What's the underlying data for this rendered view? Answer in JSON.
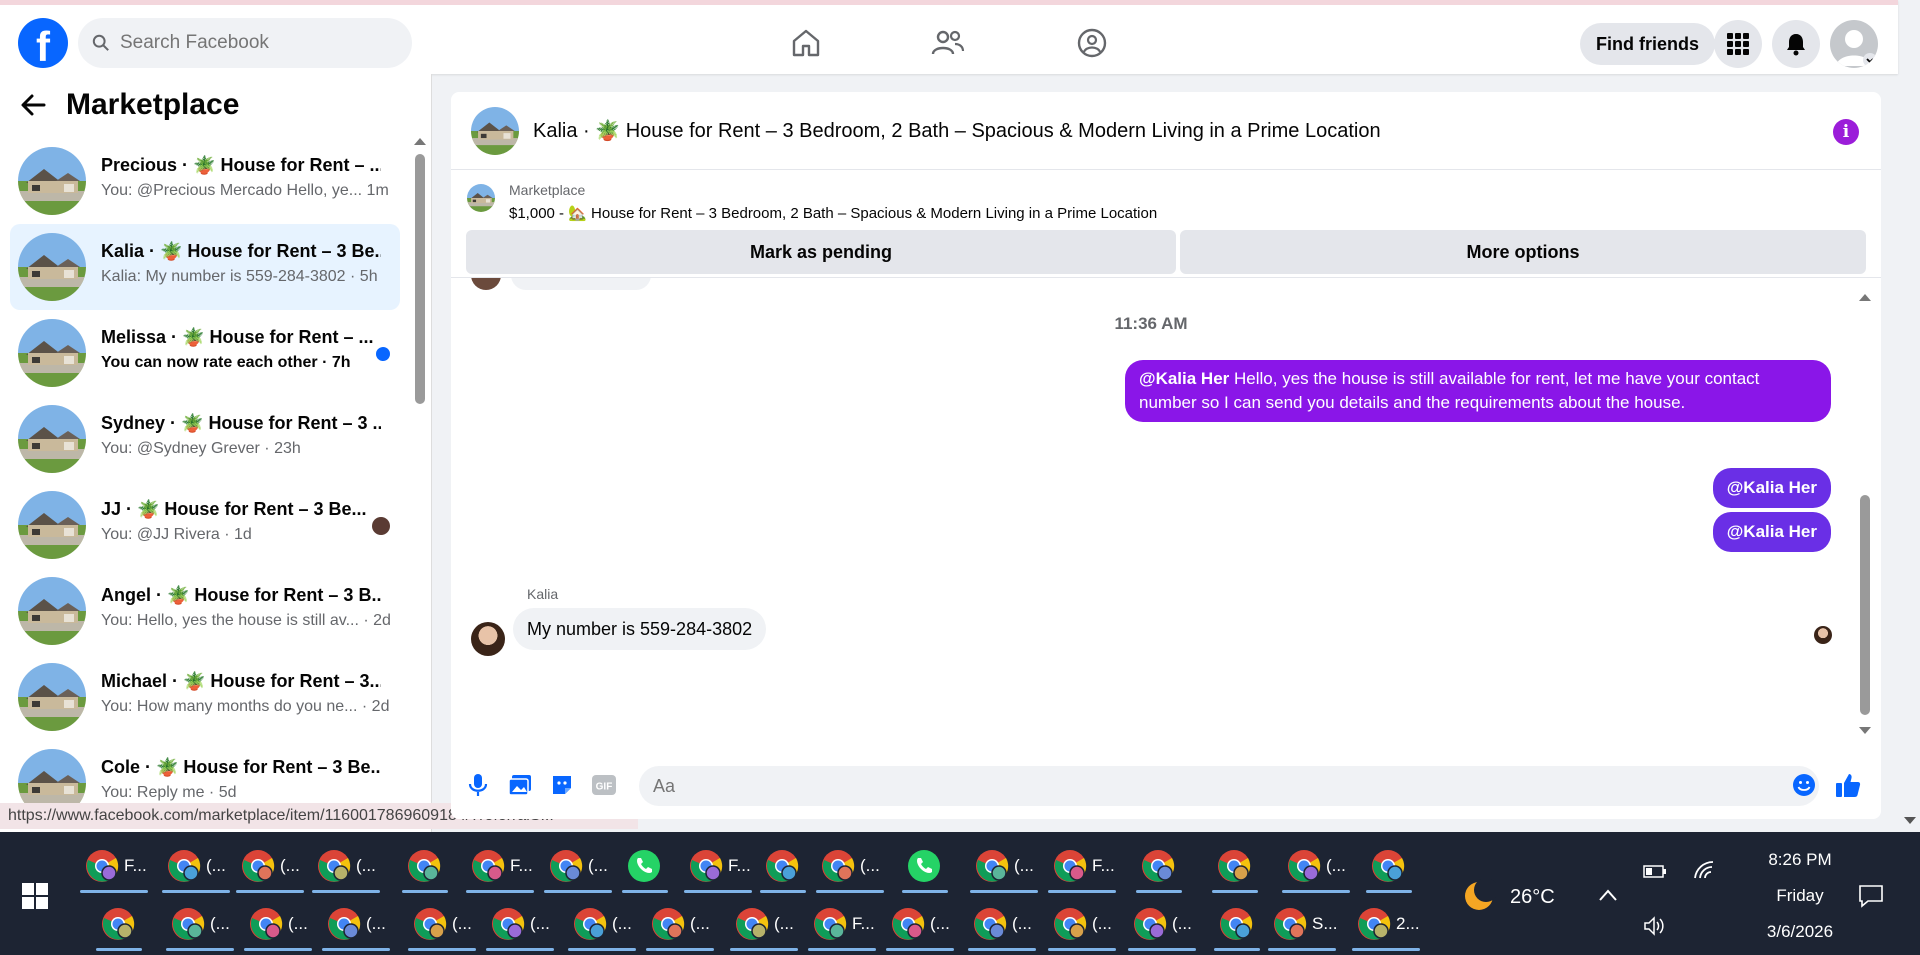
{
  "top": {
    "search_placeholder": "Search Facebook",
    "find_friends": "Find friends"
  },
  "left": {
    "title": "Marketplace",
    "conversations": [
      {
        "name": "Precious · 🪴 House for Rent – ...",
        "preview": "You: @Precious Mercado Hello, ye... 1m",
        "active": false,
        "unread": false
      },
      {
        "name": "Kalia · 🪴 House for Rent – 3 Be...",
        "preview": "Kalia: My number is 559-284-3802 · 5h",
        "active": true,
        "unread": false
      },
      {
        "name": "Melissa · 🪴 House for Rent – ...",
        "preview": "You can now rate each other · 7h",
        "active": false,
        "unread": true
      },
      {
        "name": "Sydney · 🪴 House for Rent – 3 ...",
        "preview": "You: @Sydney Grever · 23h",
        "active": false,
        "unread": false
      },
      {
        "name": "JJ · 🪴 House for Rent – 3 Be...",
        "preview": "You: @JJ Rivera · 1d",
        "active": false,
        "unread": false
      },
      {
        "name": "Angel · 🪴 House for Rent – 3 B...",
        "preview": "You: Hello, yes the house is still av... · 2d",
        "active": false,
        "unread": false
      },
      {
        "name": "Michael · 🪴 House for Rent – 3...",
        "preview": "You: How many months do you ne... · 2d",
        "active": false,
        "unread": false
      },
      {
        "name": "Cole · 🪴 House for Rent – 3 Be...",
        "preview": "You: Reply me · 5d",
        "active": false,
        "unread": false
      }
    ],
    "status_url": "https://www.facebook.com/marketplace/item/1160017869609184/?referralS..."
  },
  "chat": {
    "title": "Kalia · 🪴 House for Rent – 3 Bedroom, 2 Bath – Spacious & Modern Living in a Prime Location",
    "listing_label": "Marketplace",
    "listing_price_line": "$1,000 - 🏡 House for Rent – 3 Bedroom, 2 Bath – Spacious & Modern Living in a Prime Location",
    "mark_pending": "Mark as pending",
    "more_options": "More options",
    "timestamp": "11:36 AM",
    "out_message": {
      "mention": "@Kalia Her",
      "text": "Hello, yes the house is still available for rent, let me have your contact number so I can send you details and the requirements about the house."
    },
    "mention_bubbles": [
      "@Kalia Her",
      "@Kalia Her"
    ],
    "sender_name": "Kalia",
    "in_message": "My number is 559-284-3802",
    "composer_placeholder": "Aa"
  },
  "taskbar": {
    "row1_labels": [
      "F...",
      "(...",
      "(...",
      "(...",
      "",
      "F...",
      "(...",
      "",
      "F...",
      "",
      "(...",
      "",
      "(...",
      "F...",
      "",
      "",
      "(...",
      ""
    ],
    "row2_labels": [
      "",
      "(...",
      "(...",
      "(...",
      "(...",
      "(...",
      "(...",
      "(...",
      "(...",
      "F...",
      "(...",
      "(...",
      "(...",
      "(...",
      "",
      "S...",
      "2..."
    ],
    "weather": "26°C",
    "time": "8:26 PM",
    "day": "Friday",
    "date": "3/6/2026"
  },
  "colors": {
    "brand_blue": "#0866ff",
    "sent_purple": "#8a16e8",
    "mention_purple": "#6a2fe6",
    "active_item_bg": "#e7f3ff"
  }
}
